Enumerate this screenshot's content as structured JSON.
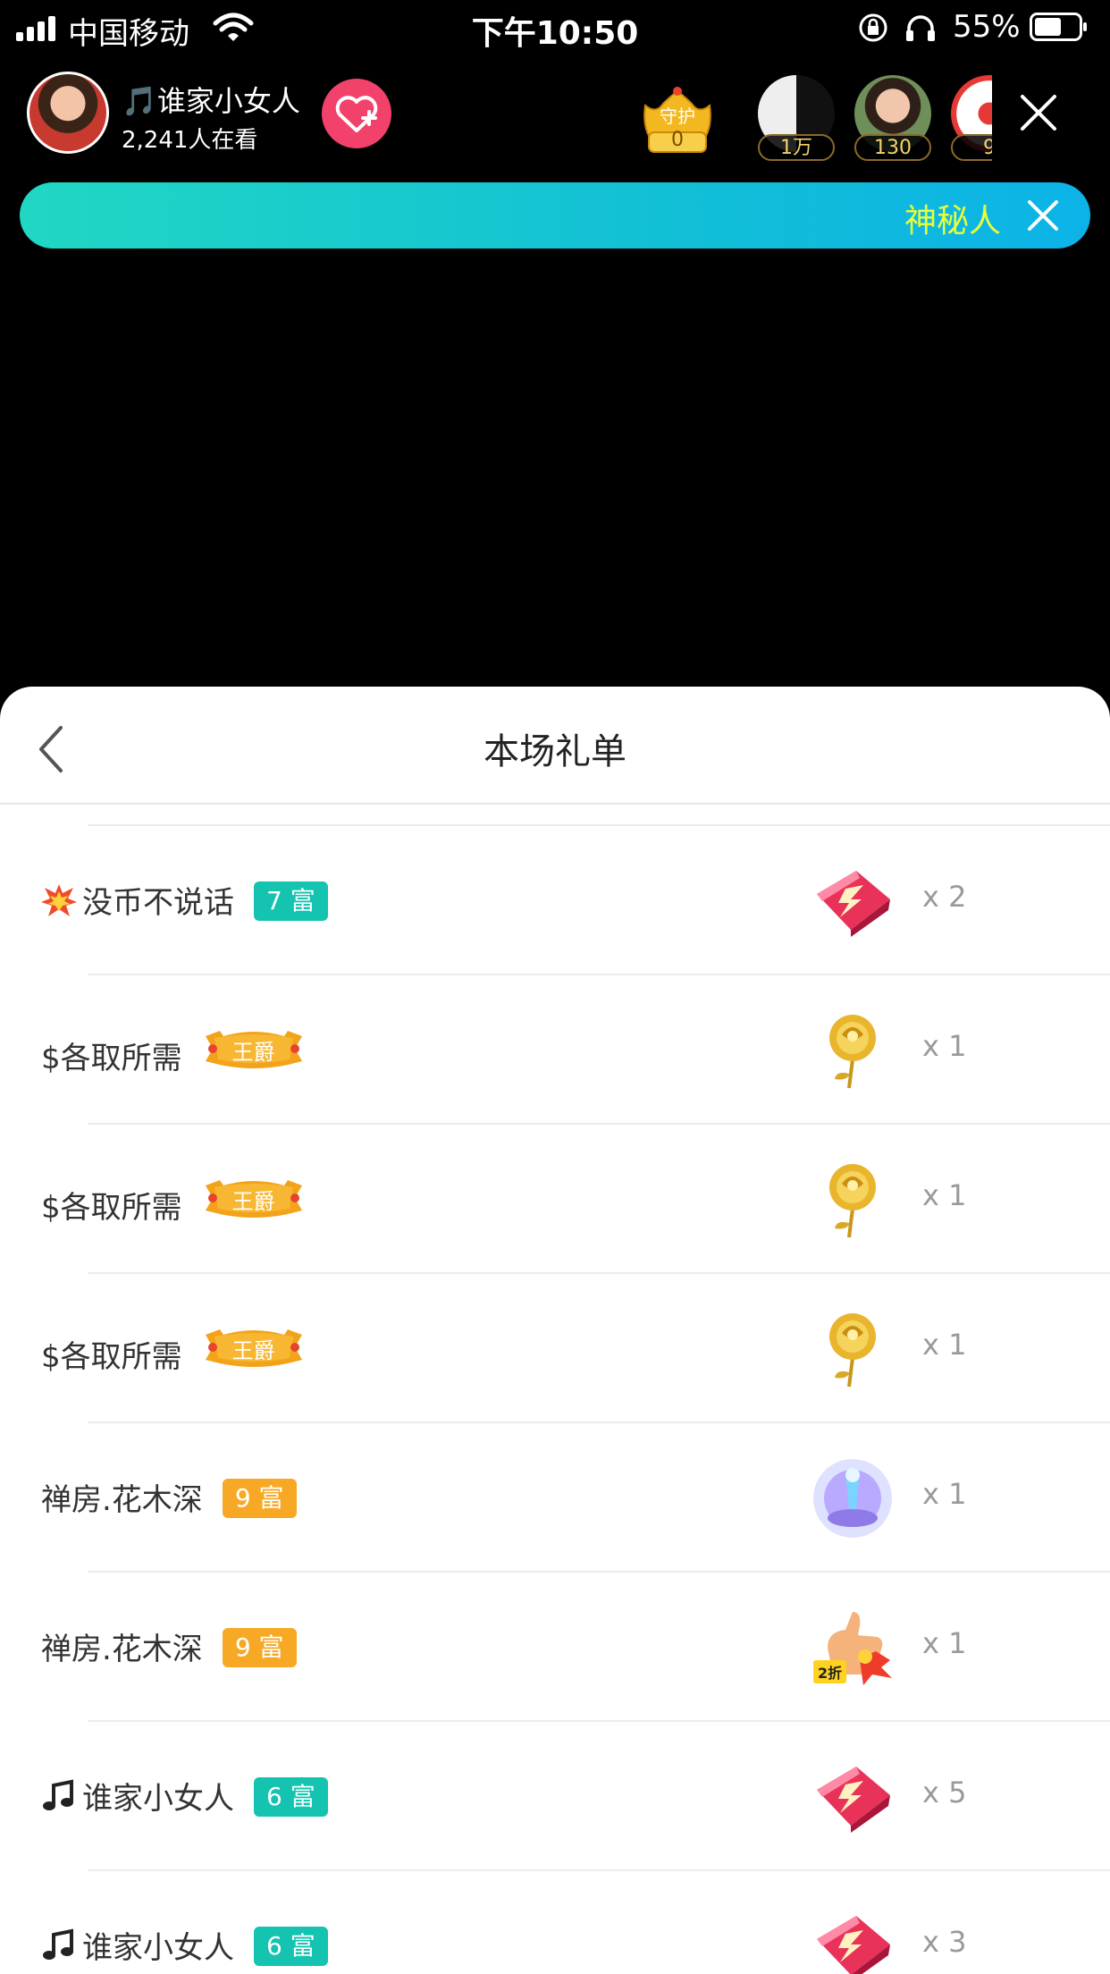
{
  "status_bar": {
    "carrier": "中国移动",
    "time": "下午10:50",
    "battery": "55%"
  },
  "header": {
    "anchor_name": "🎵谁家小女人",
    "viewers": "2,241人在看",
    "guard_label": "守护",
    "guard_count": "0",
    "top_viewers": [
      {
        "count": "1万"
      },
      {
        "count": "130"
      },
      {
        "count": "9"
      }
    ]
  },
  "banner": {
    "text": "神秘人"
  },
  "sheet": {
    "title": "本场礼单",
    "rows": [
      {
        "prefix_icon": "explosion-icon",
        "name": "没币不说话",
        "badge_type": "rich",
        "badge": "7 富",
        "gift_icon": "red-envelope-gift-icon",
        "count": "x 2"
      },
      {
        "prefix_icon": "",
        "name": "$各取所需",
        "badge_type": "duke",
        "badge": "王爵",
        "gift_icon": "golden-rose-gift-icon",
        "count": "x 1"
      },
      {
        "prefix_icon": "",
        "name": "$各取所需",
        "badge_type": "duke",
        "badge": "王爵",
        "gift_icon": "golden-rose-gift-icon",
        "count": "x 1"
      },
      {
        "prefix_icon": "",
        "name": "$各取所需",
        "badge_type": "duke",
        "badge": "王爵",
        "gift_icon": "golden-rose-gift-icon",
        "count": "x 1"
      },
      {
        "prefix_icon": "",
        "name": "禅房.花木深",
        "badge_type": "rich",
        "badge": "9 富",
        "gift_icon": "crystal-fountain-gift-icon",
        "count": "x 1"
      },
      {
        "prefix_icon": "",
        "name": "禅房.花木深",
        "badge_type": "rich",
        "badge": "9 富",
        "gift_icon": "thumbs-up-gift-icon",
        "gift_tag": "2折",
        "count": "x 1"
      },
      {
        "prefix_icon": "music-note-icon",
        "name": "谁家小女人",
        "badge_type": "rich",
        "badge": "6 富",
        "gift_icon": "red-envelope-gift-icon",
        "count": "x 5"
      },
      {
        "prefix_icon": "music-note-icon",
        "name": "谁家小女人",
        "badge_type": "rich",
        "badge": "6 富",
        "gift_icon": "red-envelope-gift-icon",
        "count": "x 3"
      }
    ]
  },
  "colors": {
    "rich_badge_teal": "#14c3b0",
    "rich_badge_orange": "#f7a925",
    "follow_button": "#f2416a",
    "banner_text": "#e8ff3a"
  }
}
